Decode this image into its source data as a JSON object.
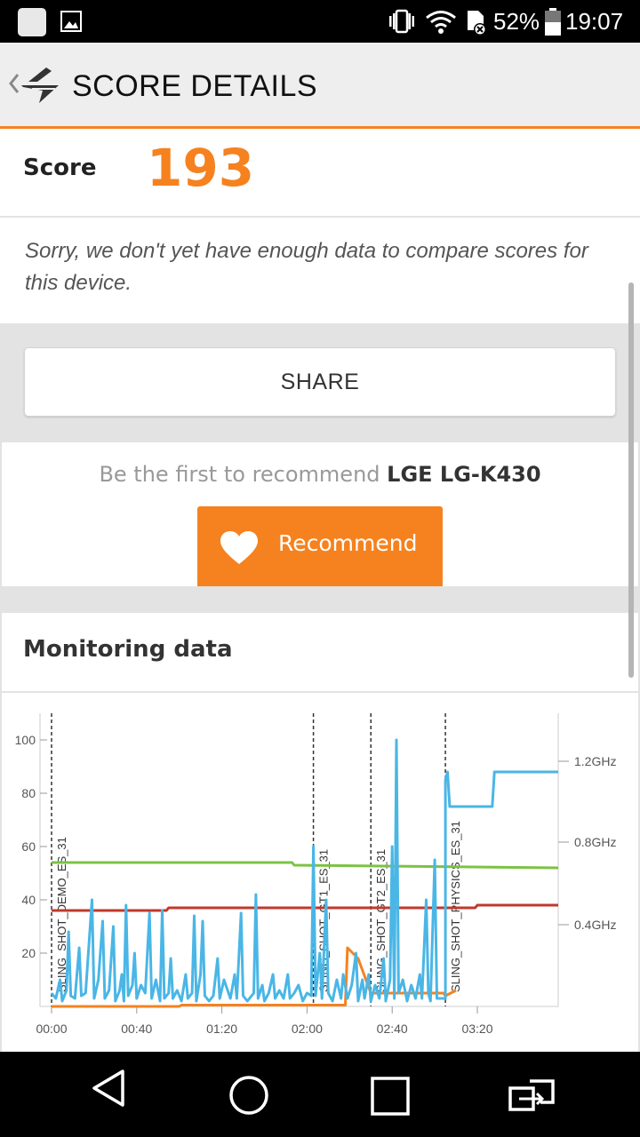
{
  "status_bar": {
    "battery": "52%",
    "time": "19:07"
  },
  "app_bar": {
    "title": "SCORE DETAILS"
  },
  "score": {
    "label": "Score",
    "value": "193"
  },
  "compare_message": "Sorry, we don't yet have enough data to compare scores for this device.",
  "share_label": "SHARE",
  "recommend": {
    "prefix": "Be the first to recommend",
    "device": "LGE LG-K430",
    "button_label": "Recommend"
  },
  "monitoring": {
    "title": "Monitoring data"
  },
  "chart_data": {
    "type": "line",
    "x_ticks": [
      "00:00",
      "00:40",
      "01:20",
      "02:00",
      "02:40",
      "03:20"
    ],
    "y_left_ticks": [
      "100",
      "80",
      "60",
      "40",
      "20"
    ],
    "y_right_ticks": [
      "1.2GHz",
      "0.8GHz",
      "0.4GHz"
    ],
    "ylim": [
      0,
      100
    ],
    "xlim_seconds": [
      0,
      238
    ],
    "markers": [
      {
        "label": "SLING_SHOT_DEMO_ES_31",
        "t": 0
      },
      {
        "label": "SLING_SHOT_GT1_ES_31",
        "t": 123
      },
      {
        "label": "SLING_SHOT_GT2_ES_31",
        "t": 150
      },
      {
        "label": "SLING_SHOT_PHYSICS_ES_31",
        "t": 185
      }
    ],
    "series": [
      {
        "color": "#7cc243",
        "points": [
          [
            0,
            54
          ],
          [
            113,
            54
          ],
          [
            114,
            53
          ],
          [
            238,
            52
          ]
        ]
      },
      {
        "color": "#c0392b",
        "points": [
          [
            0,
            36
          ],
          [
            54,
            36
          ],
          [
            55,
            37
          ],
          [
            199,
            37
          ],
          [
            200,
            38
          ],
          [
            238,
            38
          ]
        ]
      },
      {
        "color": "#f5821f",
        "points": [
          [
            0,
            0
          ],
          [
            60,
            0
          ],
          [
            61,
            0.5
          ],
          [
            120,
            0.5
          ],
          [
            138,
            0.5
          ],
          [
            139,
            22
          ],
          [
            144,
            18
          ],
          [
            150,
            5
          ],
          [
            184,
            5
          ],
          [
            185,
            4
          ],
          [
            190,
            6
          ]
        ]
      },
      {
        "color": "#4ab6e6",
        "points": [
          [
            0,
            5
          ],
          [
            2,
            3
          ],
          [
            4,
            10
          ],
          [
            5,
            2
          ],
          [
            7,
            6
          ],
          [
            8,
            28
          ],
          [
            9,
            4
          ],
          [
            11,
            3
          ],
          [
            13,
            22
          ],
          [
            14,
            4
          ],
          [
            16,
            5
          ],
          [
            19,
            40
          ],
          [
            20,
            3
          ],
          [
            22,
            10
          ],
          [
            24,
            32
          ],
          [
            25,
            3
          ],
          [
            27,
            6
          ],
          [
            29,
            30
          ],
          [
            30,
            2
          ],
          [
            32,
            6
          ],
          [
            33,
            12
          ],
          [
            34,
            2
          ],
          [
            35,
            38
          ],
          [
            36,
            4
          ],
          [
            38,
            8
          ],
          [
            39,
            20
          ],
          [
            40,
            3
          ],
          [
            42,
            8
          ],
          [
            44,
            5
          ],
          [
            46,
            35
          ],
          [
            47,
            3
          ],
          [
            49,
            10
          ],
          [
            51,
            2
          ],
          [
            52,
            36
          ],
          [
            53,
            3
          ],
          [
            55,
            5
          ],
          [
            56,
            18
          ],
          [
            57,
            3
          ],
          [
            59,
            6
          ],
          [
            61,
            2
          ],
          [
            63,
            12
          ],
          [
            64,
            3
          ],
          [
            66,
            5
          ],
          [
            67,
            34
          ],
          [
            68,
            2
          ],
          [
            70,
            12
          ],
          [
            71,
            32
          ],
          [
            72,
            4
          ],
          [
            74,
            2
          ],
          [
            76,
            4
          ],
          [
            78,
            18
          ],
          [
            79,
            3
          ],
          [
            81,
            10
          ],
          [
            84,
            3
          ],
          [
            86,
            12
          ],
          [
            87,
            3
          ],
          [
            89,
            35
          ],
          [
            90,
            4
          ],
          [
            92,
            2
          ],
          [
            95,
            5
          ],
          [
            96,
            42
          ],
          [
            97,
            3
          ],
          [
            99,
            8
          ],
          [
            100,
            2
          ],
          [
            102,
            5
          ],
          [
            104,
            12
          ],
          [
            105,
            3
          ],
          [
            107,
            6
          ],
          [
            109,
            3
          ],
          [
            111,
            12
          ],
          [
            112,
            3
          ],
          [
            114,
            5
          ],
          [
            116,
            8
          ],
          [
            118,
            2
          ],
          [
            120,
            5
          ],
          [
            122,
            4
          ],
          [
            123,
            60
          ],
          [
            124,
            4
          ],
          [
            126,
            20
          ],
          [
            127,
            3
          ],
          [
            129,
            40
          ],
          [
            130,
            5
          ],
          [
            132,
            2
          ],
          [
            134,
            10
          ],
          [
            136,
            3
          ],
          [
            137,
            12
          ],
          [
            139,
            3
          ],
          [
            141,
            8
          ],
          [
            143,
            20
          ],
          [
            144,
            2
          ],
          [
            146,
            10
          ],
          [
            147,
            3
          ],
          [
            149,
            12
          ],
          [
            150,
            2
          ],
          [
            152,
            8
          ],
          [
            154,
            3
          ],
          [
            156,
            18
          ],
          [
            157,
            2
          ],
          [
            159,
            10
          ],
          [
            160,
            60
          ],
          [
            161,
            3
          ],
          [
            162,
            100
          ],
          [
            163,
            5
          ],
          [
            165,
            10
          ],
          [
            167,
            2
          ],
          [
            169,
            8
          ],
          [
            171,
            3
          ],
          [
            173,
            12
          ],
          [
            174,
            3
          ],
          [
            176,
            40
          ],
          [
            177,
            5
          ],
          [
            178,
            2
          ],
          [
            180,
            55
          ],
          [
            181,
            3
          ],
          [
            185,
            3
          ],
          [
            185,
            85
          ],
          [
            186,
            88
          ],
          [
            187,
            75
          ],
          [
            207,
            75
          ],
          [
            208,
            88
          ],
          [
            238,
            88
          ]
        ]
      }
    ]
  }
}
